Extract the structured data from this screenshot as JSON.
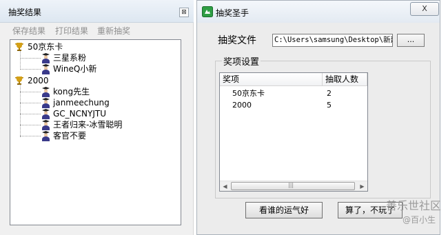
{
  "left_window": {
    "title": "抽奖结果",
    "close_glyph": "⊠",
    "menu": [
      "保存结果",
      "打印结果",
      "重新抽奖"
    ],
    "tree": [
      {
        "label": "50京东卡",
        "children": [
          "三星系粉",
          "WineQ小新"
        ]
      },
      {
        "label": "2000",
        "children": [
          "kong先生",
          "janmeechung",
          "GC_NCNYJTU",
          "王者归来-冰雪聪明",
          "客官不要"
        ]
      }
    ]
  },
  "right_window": {
    "title": "抽奖圣手",
    "close_glyph": "X",
    "file_label": "抽奖文件",
    "file_path": "C:\\Users\\samsung\\Desktop\\新建",
    "browse_label": "...",
    "group_label": "奖项设置",
    "columns": [
      "奖项",
      "抽取人数"
    ],
    "rows": [
      [
        "50京东卡",
        "2"
      ],
      [
        "2000",
        "5"
      ]
    ],
    "scroll_left": "◀",
    "scroll_right": "▶",
    "scroll_grip": "|||",
    "lucky_button": "看谁的运气好",
    "quit_button": "算了，不玩了"
  },
  "watermark": {
    "text": "善乐世社区",
    "handle": "@百小生"
  },
  "colors": {
    "window_bg": "#f0f0f0",
    "disabled_text": "#8e8e8e",
    "trophy": "#d4a017"
  },
  "icons": {
    "trophy": "trophy-icon",
    "person": "user-avatar-icon",
    "app": "app-icon"
  }
}
